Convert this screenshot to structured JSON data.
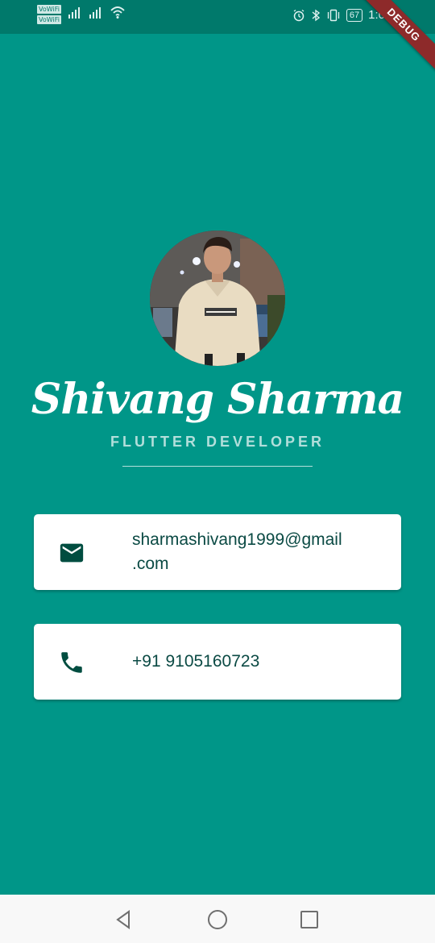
{
  "status_bar": {
    "vowifi_1": "VoWiFi",
    "vowifi_2": "VoWiFi",
    "battery": "67",
    "time": "1:0"
  },
  "debug_banner": "DEBUG",
  "profile": {
    "name": "Shivang Sharma",
    "title": "FLUTTER DEVELOPER"
  },
  "contact": {
    "email": "sharmashivang1999@gmail​.com",
    "phone": "+91 9105160723"
  },
  "colors": {
    "background": "#009688",
    "status_bar": "#00796b",
    "card": "#ffffff",
    "card_text": "#0b4a44",
    "icon": "#004d40",
    "subtitle": "#b2dfdb",
    "debug_ribbon": "#8d2a2a"
  },
  "icons": {
    "email": "mail-icon",
    "phone": "phone-icon",
    "nav_back": "back-triangle-icon",
    "nav_home": "home-circle-icon",
    "nav_recents": "recents-square-icon"
  }
}
